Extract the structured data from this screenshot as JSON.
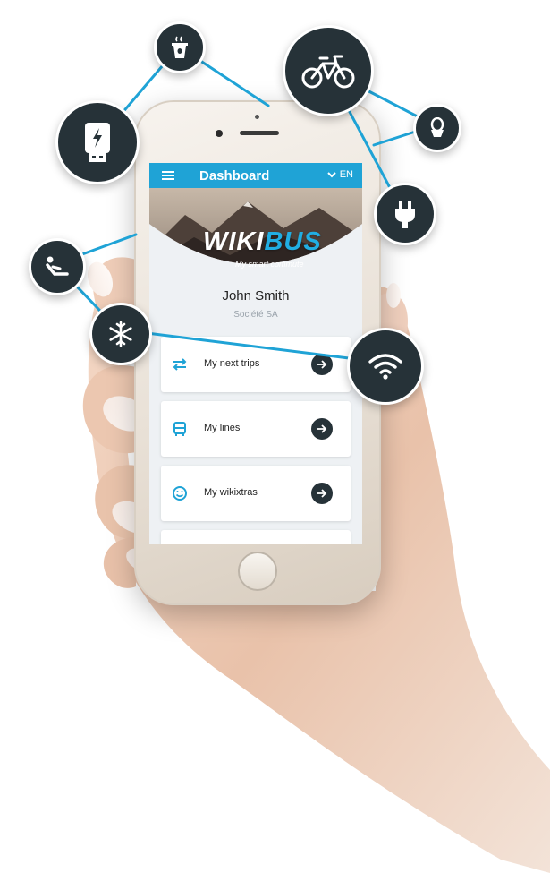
{
  "app": {
    "title": "Dashboard",
    "language": "EN",
    "logo_part1": "WIKI",
    "logo_part2": "BUS",
    "tagline": "My smart commute"
  },
  "user": {
    "name": "John Smith",
    "company": "Société SA"
  },
  "menu": [
    {
      "label": "My next trips",
      "icon": "swap-arrows-icon"
    },
    {
      "label": "My lines",
      "icon": "bus-icon"
    },
    {
      "label": "My wikixtras",
      "icon": "smiley-icon"
    }
  ],
  "amenities": [
    "coffee-icon",
    "usb-charger-icon",
    "bicycle-icon",
    "toilet-icon",
    "power-plug-icon",
    "reclining-seat-icon",
    "air-conditioning-icon",
    "wifi-icon"
  ],
  "colors": {
    "accent": "#1fa3d6",
    "dark": "#263238",
    "network_line": "#1fa3d6"
  }
}
